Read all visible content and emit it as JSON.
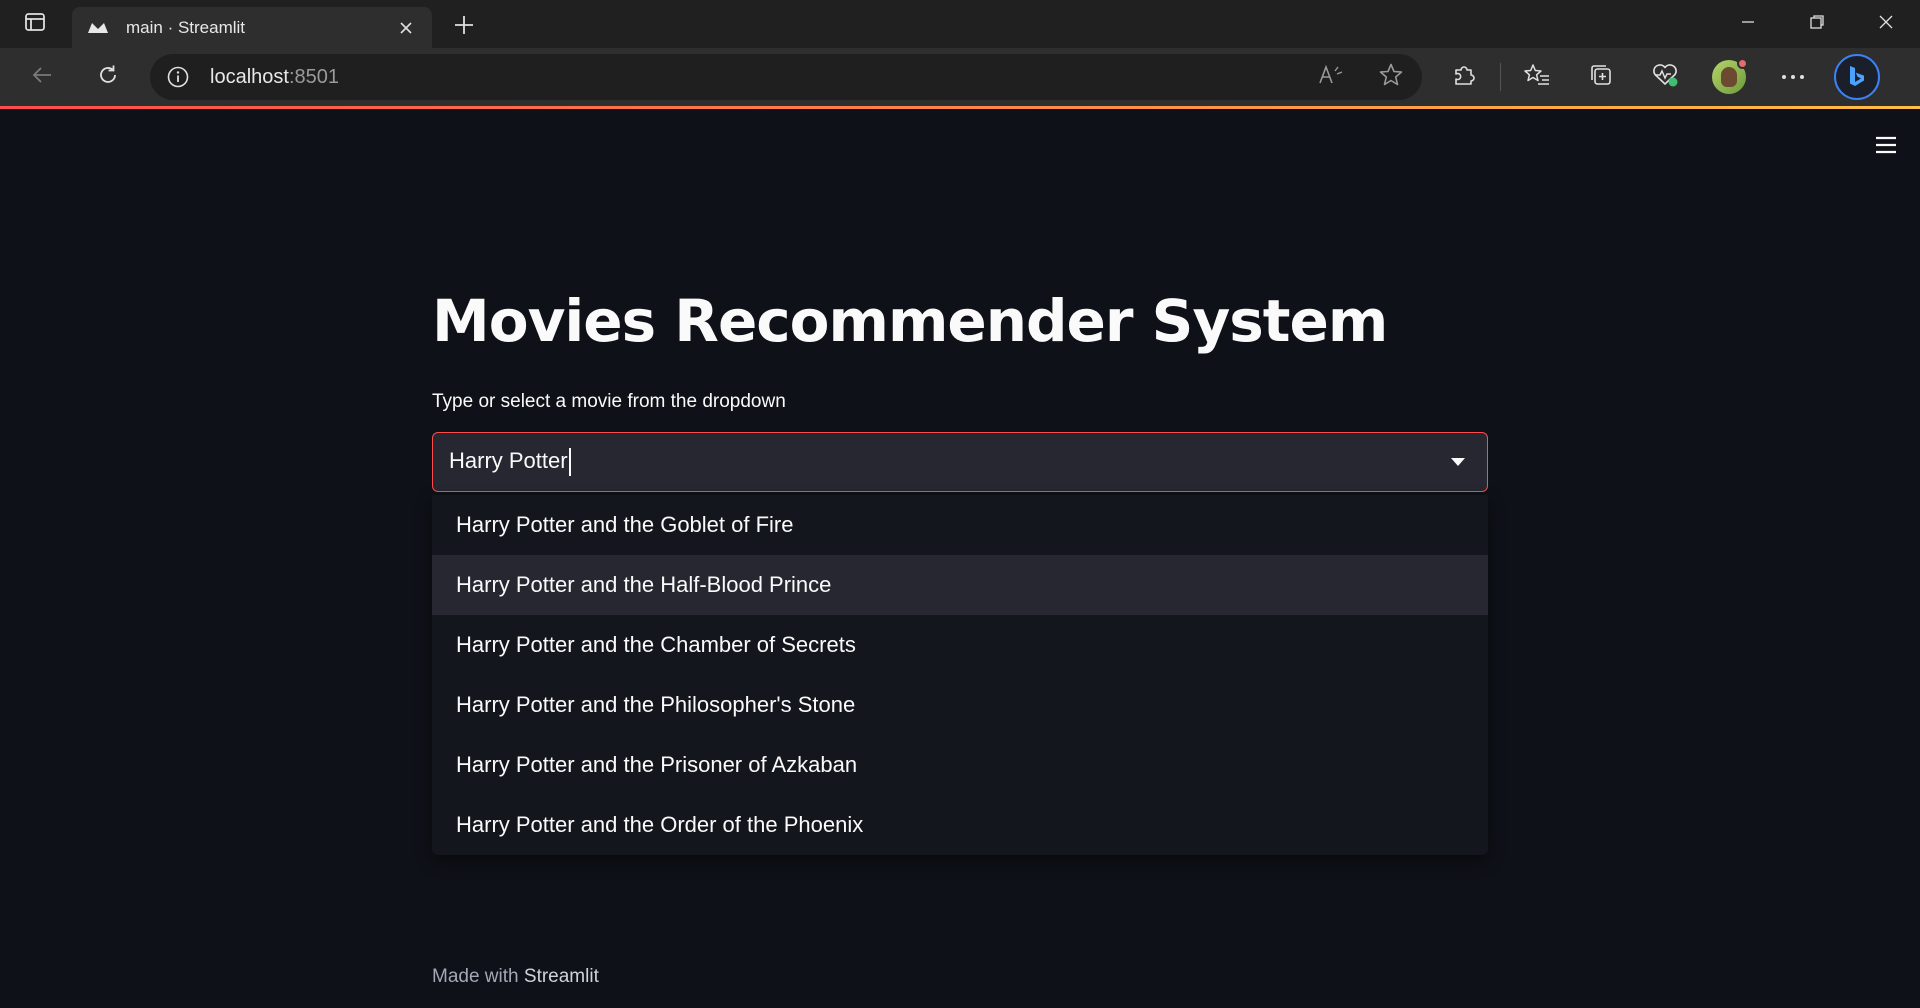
{
  "browser": {
    "tab_title": "main · Streamlit",
    "url_host": "localhost",
    "url_port": ":8501"
  },
  "app": {
    "title": "Movies Recommender System",
    "select_label": "Type or select a movie from the dropdown",
    "select_value": "Harry Potter",
    "options": [
      "Harry Potter and the Goblet of Fire",
      "Harry Potter and the Half-Blood Prince",
      "Harry Potter and the Chamber of Secrets",
      "Harry Potter and the Philosopher's Stone",
      "Harry Potter and the Prisoner of Azkaban",
      "Harry Potter and the Order of the Phoenix"
    ],
    "highlighted_option": "Harry Potter and the Half-Blood Prince"
  },
  "footer": {
    "prefix": "Made with",
    "brand": "Streamlit"
  },
  "colors": {
    "background": "#0e1117",
    "accent": "#ff4b4b",
    "input_bg": "#262730"
  }
}
